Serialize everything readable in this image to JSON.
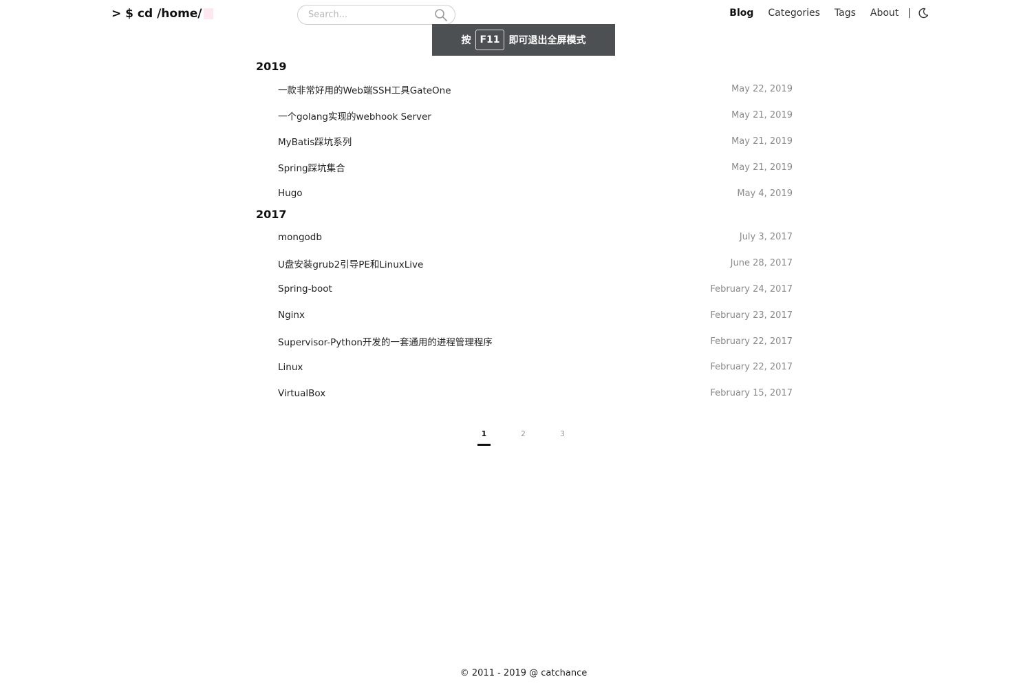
{
  "site": {
    "logo": "> $ cd /home/"
  },
  "search": {
    "placeholder": "Search..."
  },
  "nav": {
    "items": [
      {
        "label": "Blog",
        "active": true
      },
      {
        "label": "Categories",
        "active": false
      },
      {
        "label": "Tags",
        "active": false
      },
      {
        "label": "About",
        "active": false
      }
    ],
    "separator": "|",
    "theme_icon": "moon-icon"
  },
  "toast": {
    "prefix": "按",
    "key": "F11",
    "suffix": "即可退出全屏模式"
  },
  "archive": [
    {
      "year": "2019",
      "posts": [
        {
          "title": "一款非常好用的Web端SSH工具GateOne",
          "date": "May 22, 2019"
        },
        {
          "title": "一个golang实现的webhook Server",
          "date": "May 21, 2019"
        },
        {
          "title": "MyBatis踩坑系列",
          "date": "May 21, 2019"
        },
        {
          "title": "Spring踩坑集合",
          "date": "May 21, 2019"
        },
        {
          "title": "Hugo",
          "date": "May 4, 2019"
        }
      ]
    },
    {
      "year": "2017",
      "posts": [
        {
          "title": "mongodb",
          "date": "July 3, 2017"
        },
        {
          "title": "U盘安装grub2引导PE和LinuxLive",
          "date": "June 28, 2017"
        },
        {
          "title": "Spring-boot",
          "date": "February 24, 2017"
        },
        {
          "title": "Nginx",
          "date": "February 23, 2017"
        },
        {
          "title": "Supervisor-Python开发的一套通用的进程管理程序",
          "date": "February 22, 2017"
        },
        {
          "title": "Linux",
          "date": "February 22, 2017"
        },
        {
          "title": "VirtualBox",
          "date": "February 15, 2017"
        }
      ]
    }
  ],
  "pagination": {
    "pages": [
      "1",
      "2",
      "3"
    ],
    "current": "1"
  },
  "footer": {
    "text": "© 2011 - 2019 @ catchance"
  },
  "colors": {
    "toast_bg": "#4d5052",
    "date_text": "#8a8a8a",
    "cursor_block": "#fde8f2"
  }
}
